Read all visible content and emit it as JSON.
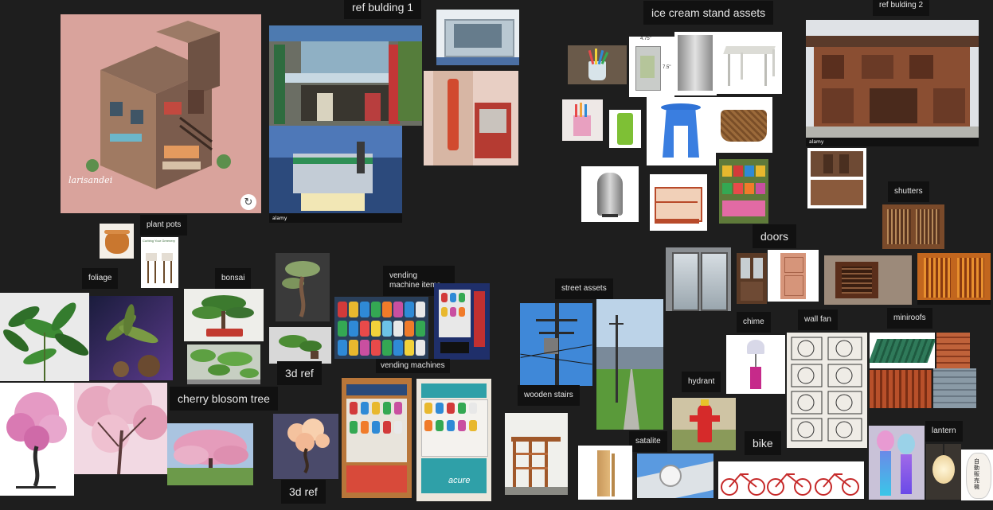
{
  "board": {
    "background": "#1e1e1e",
    "labels": {
      "ref_building_1": "ref bulding 1",
      "ice_cream": "ice cream stand assets",
      "ref_building_2": "ref bulding 2",
      "plant_pots": "plant pots",
      "foliage": "foliage",
      "bonsai": "bonsai",
      "vending_items": "vending machine items",
      "vending_machines": "vending machines",
      "ref_3d_a": "3d ref",
      "ref_3d_b": "3d ref",
      "cherry": "cherry blosom tree",
      "street_assets": "street assets",
      "wooden_stairs": "wooden stairs",
      "doors": "doors",
      "shutters": "shutters",
      "chime": "chime",
      "wall_fan": "wall fan",
      "miniroofs": "miniroofs",
      "hydrant": "hydrant",
      "satalite": "satalite",
      "bike": "bike",
      "lantern": "lantern"
    },
    "image_text": {
      "artist_signature": "larisandei",
      "watermark": "alamy",
      "dim_width": "4.75\"",
      "dim_height": "7.5\"",
      "plant_card_title": "Curbing Your Greenery",
      "acure_brand": "acure",
      "vm_sign": "自動販売機"
    },
    "colors": {
      "label_bg": "#111111",
      "label_text": "#e6e6e6",
      "accent_pink_bg": "#d9a39c"
    },
    "icons": [
      "refresh-icon"
    ]
  }
}
